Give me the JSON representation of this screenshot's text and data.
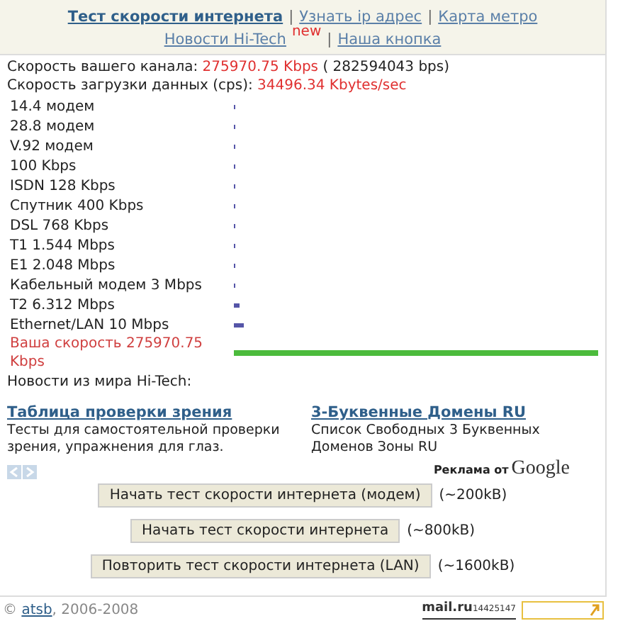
{
  "nav": {
    "links": [
      {
        "label": "Тест скорости интернета",
        "selected": true
      },
      {
        "label": "Узнать ip адрес",
        "selected": false
      },
      {
        "label": "Карта метро",
        "selected": false
      },
      {
        "label": "Новости Hi-Tech",
        "selected": false,
        "badge": "new"
      },
      {
        "label": "Наша кнопка",
        "selected": false
      }
    ],
    "separator": "|"
  },
  "summary": [
    {
      "label": "Скорость вашего канала:",
      "value": "275970.75 Kbps",
      "extra": "( 282594043 bps)"
    },
    {
      "label": "Скорость загрузки данных (cps):",
      "value": "34496.34 Kbytes/sec"
    }
  ],
  "speeds": [
    {
      "name": "14.4 модем",
      "kind": "tick"
    },
    {
      "name": "28.8 модем",
      "kind": "tick"
    },
    {
      "name": "V.92 модем",
      "kind": "tick"
    },
    {
      "name": "100 Kbps",
      "kind": "tick"
    },
    {
      "name": "ISDN 128 Kbps",
      "kind": "tick"
    },
    {
      "name": "Спутник 400 Kbps",
      "kind": "tick"
    },
    {
      "name": "DSL 768 Kbps",
      "kind": "tick"
    },
    {
      "name": "T1 1.544 Mbps",
      "kind": "tick"
    },
    {
      "name": "E1 2.048 Mbps",
      "kind": "tick"
    },
    {
      "name": "Кабельный модем 3 Mbps",
      "kind": "tick"
    },
    {
      "name": "T2 6.312 Mbps",
      "kind": "dash"
    },
    {
      "name": "Ethernet/LAN 10 Mbps",
      "kind": "wide-dash"
    },
    {
      "name": "Ваша скорость 275970.75 Kbps",
      "kind": "full"
    }
  ],
  "news_heading": "Новости из мира Hi-Tech:",
  "ads": [
    {
      "title": "Таблица проверки зрения",
      "text": "Тесты для самостоятельной проверки зрения, упражнения для глаз."
    },
    {
      "title": "3-Буквенные Домены RU",
      "text": "Список Свободных 3 Буквенных Доменов Зоны RU"
    }
  ],
  "ad_credit": {
    "prefix": "Реклама от",
    "brand": "Google"
  },
  "tests": [
    {
      "button": "Начать тест скорости интернета (модем)",
      "size": "(~200kB)"
    },
    {
      "button": "Начать тест скорости интернета",
      "size": "(~800kB)"
    },
    {
      "button": "Повторить тест скорости интернета (LAN)",
      "size": "(~1600kB)"
    }
  ],
  "footer": {
    "copyright": "©",
    "author": "atsb",
    "years": ", 2006-2008",
    "counter_logo": "mail.ru",
    "counter_value": "14425147"
  }
}
